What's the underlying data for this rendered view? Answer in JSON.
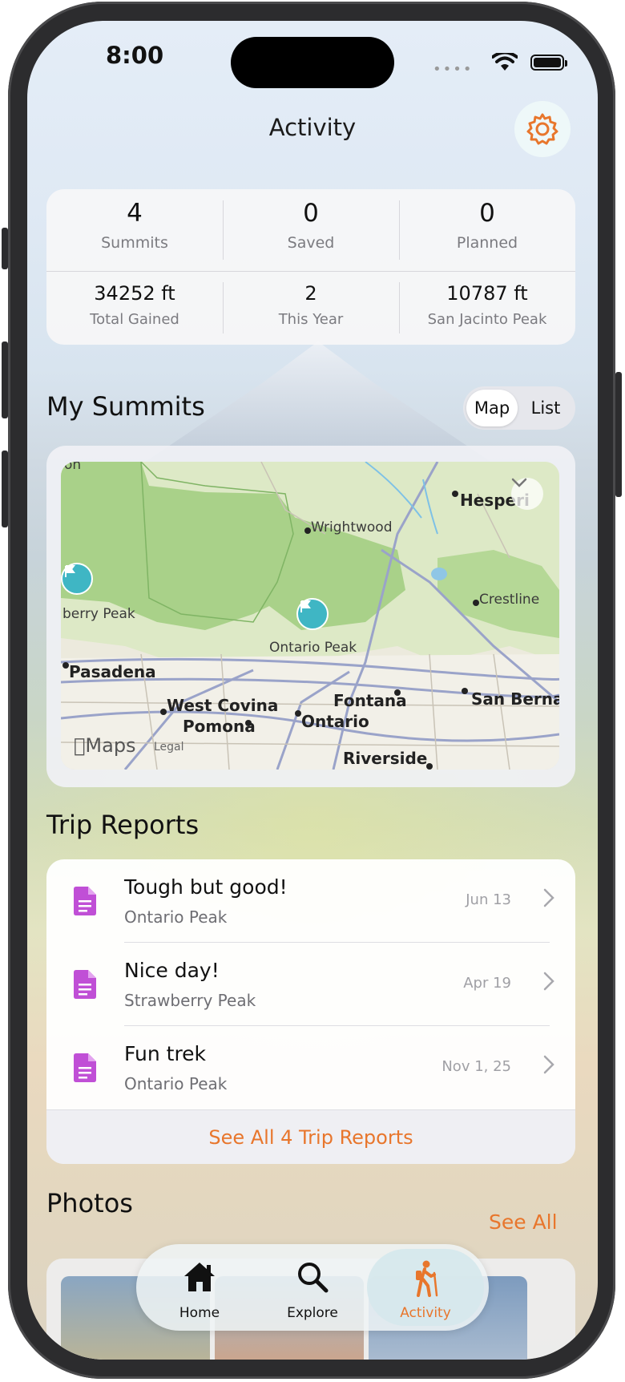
{
  "status_bar": {
    "time": "8:00"
  },
  "header": {
    "title": "Activity"
  },
  "stats": {
    "summits": {
      "value": "4",
      "label": "Summits"
    },
    "saved": {
      "value": "0",
      "label": "Saved"
    },
    "planned": {
      "value": "0",
      "label": "Planned"
    },
    "total_gained": {
      "value": "34252 ft",
      "label": "Total Gained"
    },
    "this_year": {
      "value": "2",
      "label": "This Year"
    },
    "highest": {
      "value": "10787 ft",
      "label": "San Jacinto Peak"
    }
  },
  "my_summits": {
    "title": "My Summits",
    "toggle": {
      "map": "Map",
      "list": "List",
      "selected": "Map"
    }
  },
  "map": {
    "labels": {
      "hesperia": "Hesperi",
      "wrightwood": "Wrightwood",
      "crestline": "Crestline",
      "strawberry_peak": "berry Peak",
      "ontario_peak": "Ontario Peak",
      "pasadena": "Pasadena",
      "west_covina": "West Covina",
      "fontana": "Fontana",
      "san_bernardino": "San Bernard",
      "pomona": "Pomona",
      "ontario": "Ontario",
      "riverside": "Riverside",
      "corner": "on"
    },
    "attribution": {
      "logo": "Maps",
      "legal": "Legal"
    }
  },
  "trip_reports": {
    "title": "Trip Reports",
    "items": [
      {
        "title": "Tough but good!",
        "peak": "Ontario Peak",
        "date": "Jun 13"
      },
      {
        "title": "Nice day!",
        "peak": "Strawberry Peak",
        "date": "Apr 19"
      },
      {
        "title": "Fun trek",
        "peak": "Ontario Peak",
        "date": "Nov 1, 25"
      }
    ],
    "see_all": "See All 4 Trip Reports"
  },
  "photos": {
    "title": "Photos",
    "see_all": "See All"
  },
  "tab_bar": {
    "tabs": [
      {
        "label": "Home",
        "icon": "house-icon"
      },
      {
        "label": "Explore",
        "icon": "magnifier-icon"
      },
      {
        "label": "Activity",
        "icon": "hiker-icon",
        "active": true
      }
    ]
  },
  "colors": {
    "accent": "#e8762c",
    "doc_icon": "#c04fd6",
    "pin": "#3fb6c4"
  }
}
